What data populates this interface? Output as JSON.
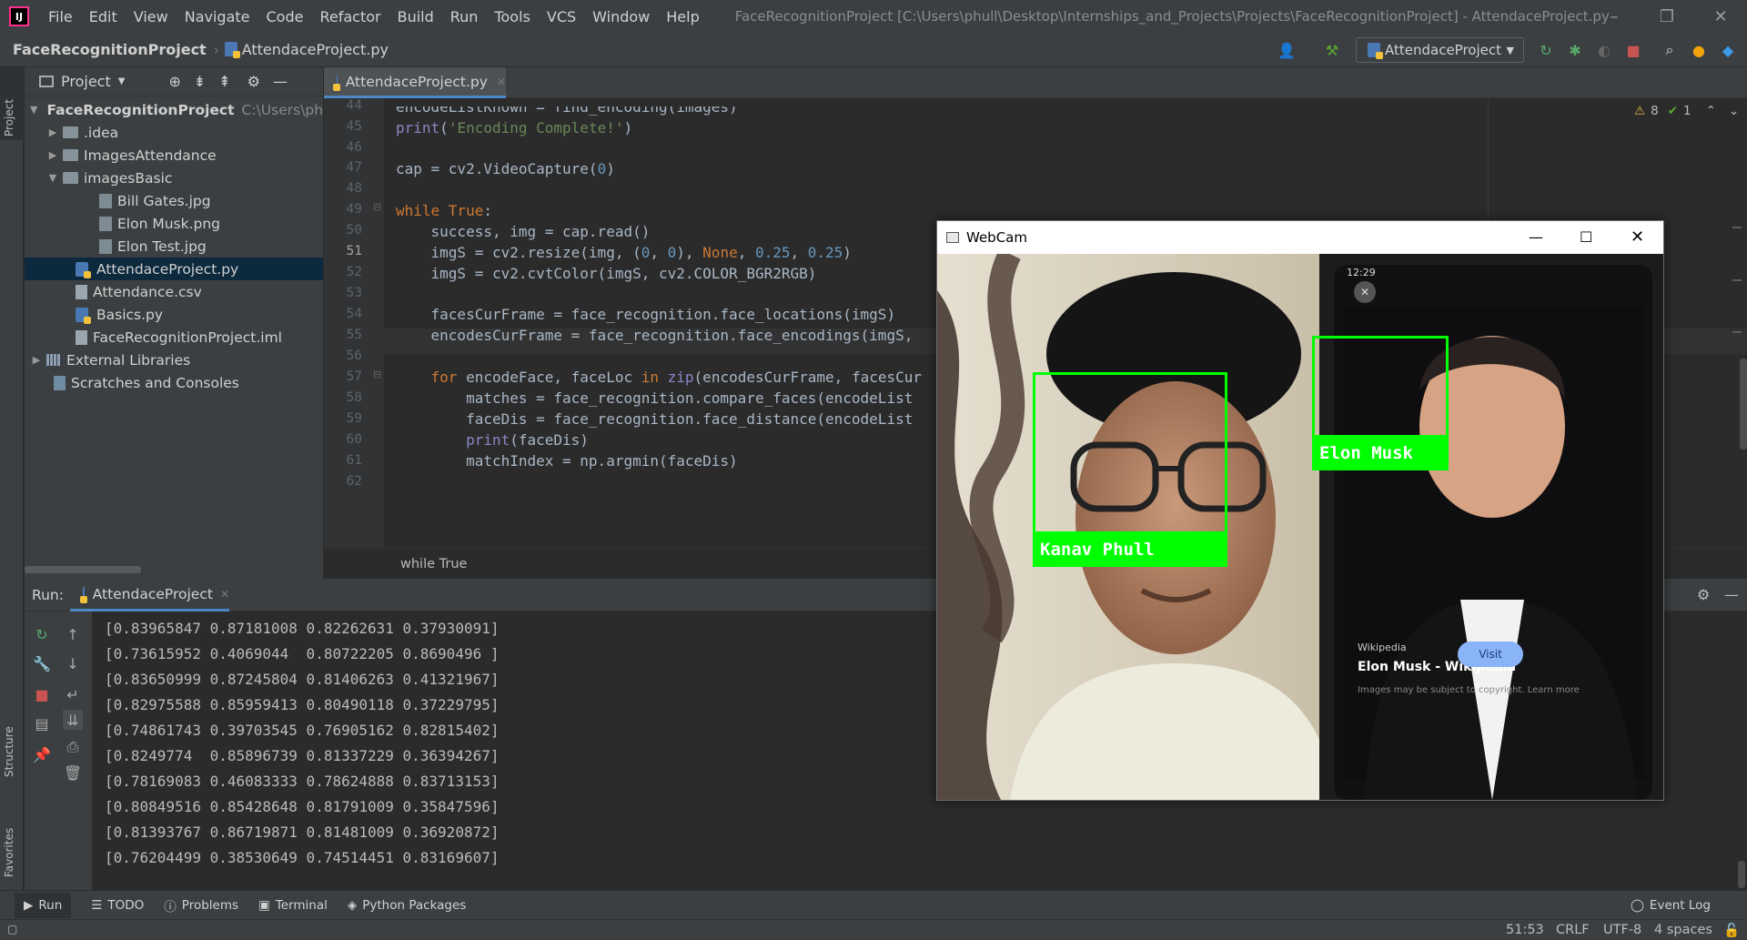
{
  "titlebar": {
    "menu": [
      "File",
      "Edit",
      "View",
      "Navigate",
      "Code",
      "Refactor",
      "Build",
      "Run",
      "Tools",
      "VCS",
      "Window",
      "Help"
    ],
    "window_title": "FaceRecognitionProject [C:\\Users\\phull\\Desktop\\Internships_and_Projects\\Projects\\FaceRecognitionProject] - AttendaceProject.py",
    "logo": "IJ"
  },
  "navbar": {
    "project": "FaceRecognitionProject",
    "file": "AttendaceProject.py",
    "run_config": "AttendaceProject"
  },
  "left_strip": {
    "project_tab": "Project",
    "structure_tab": "Structure",
    "favorites_tab": "Favorites"
  },
  "project_panel": {
    "title": "Project",
    "tree": [
      {
        "label": "FaceRecognitionProject",
        "path": "C:\\Users\\phu",
        "kind": "root"
      },
      {
        "label": ".idea",
        "kind": "folder"
      },
      {
        "label": "ImagesAttendance",
        "kind": "folder"
      },
      {
        "label": "imagesBasic",
        "kind": "folder"
      },
      {
        "label": "Bill Gates.jpg",
        "kind": "image"
      },
      {
        "label": "Elon Musk.png",
        "kind": "image"
      },
      {
        "label": "Elon Test.jpg",
        "kind": "image"
      },
      {
        "label": "AttendaceProject.py",
        "kind": "py"
      },
      {
        "label": "Attendance.csv",
        "kind": "text"
      },
      {
        "label": "Basics.py",
        "kind": "py"
      },
      {
        "label": "FaceRecognitionProject.iml",
        "kind": "text"
      },
      {
        "label": "External Libraries",
        "kind": "lib"
      },
      {
        "label": "Scratches and Consoles",
        "kind": "scratch"
      }
    ]
  },
  "editor": {
    "tab": "AttendaceProject.py",
    "inspection": {
      "warnings": "8",
      "weak_warnings": "1"
    },
    "line_numbers": [
      "44",
      "45",
      "46",
      "47",
      "48",
      "49",
      "50",
      "51",
      "52",
      "53",
      "54",
      "55",
      "56",
      "57",
      "58",
      "59",
      "60",
      "61",
      "62"
    ],
    "breadcrumb": "while True"
  },
  "run_panel": {
    "label": "Run:",
    "tab": "AttendaceProject",
    "output": [
      "[0.83965847 0.87181008 0.82262631 0.37930091]",
      "[0.73615952 0.4069044  0.80722205 0.8690496 ]",
      "[0.83650999 0.87245804 0.81406263 0.41321967]",
      "[0.82975588 0.85959413 0.80490118 0.37229795]",
      "[0.74861743 0.39703545 0.76905162 0.82815402]",
      "[0.8249774  0.85896739 0.81337229 0.36394267]",
      "[0.78169083 0.46083333 0.78624888 0.83713153]",
      "[0.80849516 0.85428648 0.81791009 0.35847596]",
      "[0.81393767 0.86719871 0.81481009 0.36920872]",
      "[0.76204499 0.38530649 0.74514451 0.83169607]"
    ]
  },
  "toolwindows": [
    "Run",
    "TODO",
    "Problems",
    "Terminal",
    "Python Packages"
  ],
  "event_log": "Event Log",
  "status": {
    "position": "51:53",
    "line_sep": "CRLF",
    "encoding": "UTF-8",
    "indent": "4 spaces"
  },
  "webcam": {
    "title": "WebCam",
    "face1": "Kanav Phull",
    "face2": "Elon Musk",
    "phone_time": "12:29",
    "phone_source": "Wikipedia",
    "phone_title": "Elon Musk - Wikipedia",
    "phone_visit": "Visit",
    "phone_copyright": "Images may be subject to copyright. Learn more"
  },
  "colors": {
    "accent": "#4a88c7",
    "box_green": "#00ff00",
    "stop_red": "#c75450"
  }
}
